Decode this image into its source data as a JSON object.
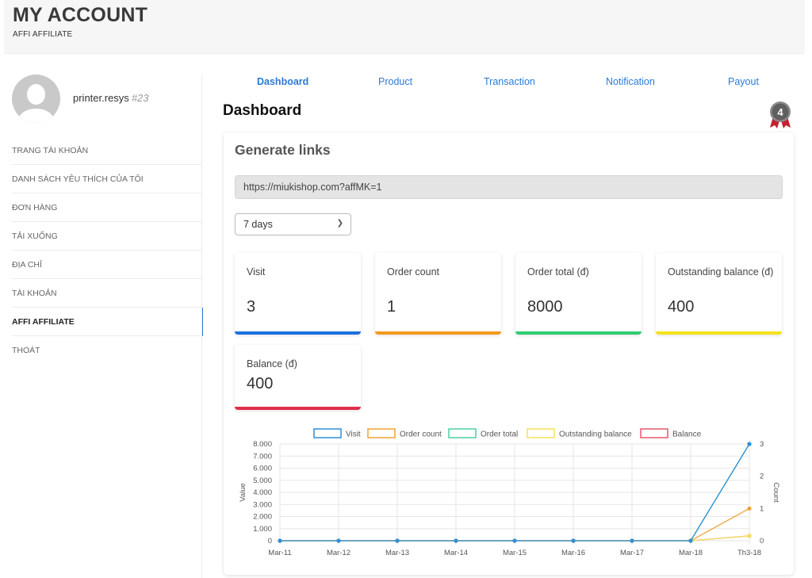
{
  "header": {
    "title": "MY ACCOUNT",
    "breadcrumb": "AFFI AFFILIATE"
  },
  "user": {
    "name": "printer.resys",
    "id": "#23"
  },
  "menu": [
    {
      "label": "TRANG TÀI KHOẢN"
    },
    {
      "label": "DANH SÁCH YÊU THÍCH CỦA TÔI"
    },
    {
      "label": "ĐƠN HÀNG"
    },
    {
      "label": "TẢI XUỐNG"
    },
    {
      "label": "ĐỊA CHỈ"
    },
    {
      "label": "TÀI KHOẢN"
    },
    {
      "label": "AFFI AFFILIATE",
      "active": true
    },
    {
      "label": "THOÁT"
    }
  ],
  "tabs": [
    {
      "label": "Dashboard",
      "active": true
    },
    {
      "label": "Product"
    },
    {
      "label": "Transaction"
    },
    {
      "label": "Notification"
    },
    {
      "label": "Payout"
    }
  ],
  "main": {
    "title": "Dashboard",
    "level_badge": "4"
  },
  "generate": {
    "title": "Generate links",
    "link": "https://miukishop.com?affMK=1",
    "period": "7 days"
  },
  "stats": [
    {
      "label": "Visit",
      "value": "3",
      "color": "#1a6fe0"
    },
    {
      "label": "Order count",
      "value": "1",
      "color": "#f39a1f"
    },
    {
      "label": "Order total (đ)",
      "value": "8000",
      "color": "#2ecc71"
    },
    {
      "label": "Outstanding balance (đ)",
      "value": "400",
      "color": "#f4e21a"
    },
    {
      "label": "Balance (đ)",
      "value": "400",
      "color": "#e02d4a"
    }
  ],
  "chart_data": {
    "type": "line",
    "categories": [
      "Mar-11",
      "Mar-12",
      "Mar-13",
      "Mar-14",
      "Mar-15",
      "Mar-16",
      "Mar-17",
      "Mar-18",
      "Th3-18"
    ],
    "ylabel": "Value",
    "y2label": "Count",
    "ylim": [
      0,
      8000
    ],
    "y_ticks": [
      "0",
      "1.000",
      "2.000",
      "3.000",
      "4.000",
      "5.000",
      "6.000",
      "7.000",
      "8.000"
    ],
    "y2lim": [
      0,
      3
    ],
    "y2_ticks": [
      "0",
      "1",
      "2",
      "3"
    ],
    "legend_position": "top",
    "grid": true,
    "series": [
      {
        "name": "Visit",
        "axis": "right",
        "color": "#2f8fd8",
        "values": [
          0,
          0,
          0,
          0,
          0,
          0,
          0,
          0,
          3
        ]
      },
      {
        "name": "Order count",
        "axis": "right",
        "color": "#f0a336",
        "values": [
          0,
          0,
          0,
          0,
          0,
          0,
          0,
          0,
          1
        ]
      },
      {
        "name": "Order total",
        "axis": "left",
        "color": "#4bd0a2",
        "values": [
          0,
          0,
          0,
          0,
          0,
          0,
          0,
          0,
          8000
        ]
      },
      {
        "name": "Outstanding balance",
        "axis": "left",
        "color": "#f6e05e",
        "values": [
          0,
          0,
          0,
          0,
          0,
          0,
          0,
          0,
          400
        ]
      },
      {
        "name": "Balance",
        "axis": "left",
        "color": "#e8566e",
        "values": [
          0,
          0,
          0,
          0,
          0,
          0,
          0,
          0,
          400
        ]
      }
    ]
  }
}
